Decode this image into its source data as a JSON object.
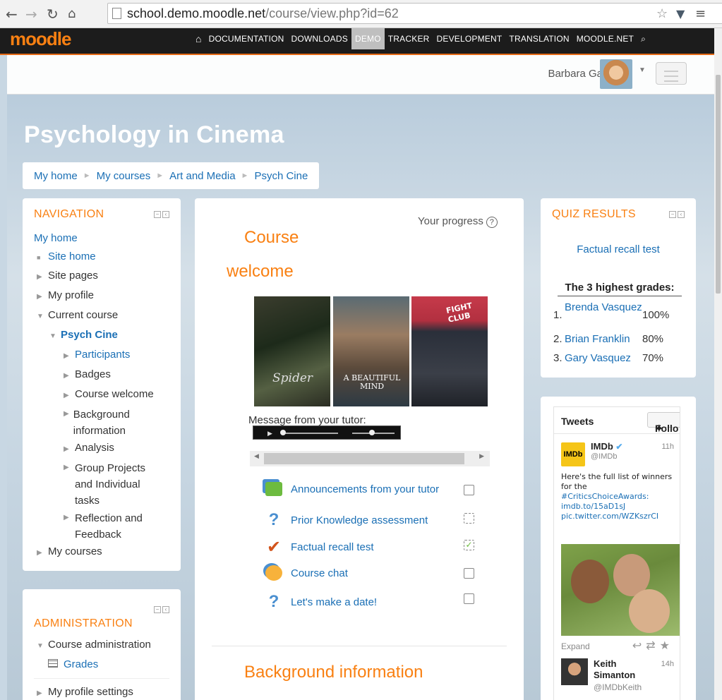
{
  "browser": {
    "url_host": "school.demo.moodle.net",
    "url_path": "/course/view.php?id=62"
  },
  "site": {
    "logo": "moodle",
    "menu": [
      "DOCUMENTATION",
      "DOWNLOADS",
      "DEMO",
      "TRACKER",
      "DEVELOPMENT",
      "TRANSLATION",
      "MOODLE.NET"
    ],
    "active_menu": "DEMO"
  },
  "user": {
    "name": "Barbara Gardner"
  },
  "course": {
    "title": "Psychology in Cinema"
  },
  "breadcrumb": [
    "My home",
    "My courses",
    "Art and Media",
    "Psych Cine"
  ],
  "navigation": {
    "title": "NAVIGATION",
    "my_home": "My home",
    "site_home": "Site home",
    "site_pages": "Site pages",
    "my_profile": "My profile",
    "current_course": "Current course",
    "course_short": "Psych Cine",
    "items": [
      "Participants",
      "Badges",
      "Course welcome",
      "Background information",
      "Analysis",
      "Group Projects and Individual tasks",
      "Reflection and Feedback"
    ],
    "my_courses": "My courses"
  },
  "administration": {
    "title": "ADMINISTRATION",
    "course_admin": "Course administration",
    "grades": "Grades",
    "profile_settings": "My profile settings"
  },
  "main": {
    "progress_label": "Your progress",
    "section_title_1": "Course",
    "section_title_2": "welcome",
    "poster_texts": [
      "Spider",
      "A BEAUTIFUL MIND",
      "FIGHT CLUB"
    ],
    "message_label": "Message from your tutor:",
    "activities": [
      {
        "label": "Announcements from your tutor",
        "icon": "forum-icon"
      },
      {
        "label": "Prior Knowledge assessment",
        "icon": "question-icon"
      },
      {
        "label": "Factual recall test",
        "icon": "quiz-icon"
      },
      {
        "label": "Course chat",
        "icon": "chat-icon"
      },
      {
        "label": "Let's make a date!",
        "icon": "question-icon"
      }
    ],
    "next_section": "Background information"
  },
  "quiz": {
    "title": "QUIZ RESULTS",
    "test_name": "Factual recall test",
    "highest_label": "The 3 highest grades:",
    "results": [
      {
        "rank": "1.",
        "name": "Brenda Vasquez",
        "grade": "100%"
      },
      {
        "rank": "2.",
        "name": "Brian Franklin",
        "grade": "80%"
      },
      {
        "rank": "3.",
        "name": "Gary Vasquez",
        "grade": "70%"
      }
    ]
  },
  "tweets": {
    "title": "Tweets",
    "follow": "Follo",
    "t1_name": "IMDb",
    "t1_handle": "@IMDb",
    "t1_time": "11h",
    "t1_text": "Here's the full list of winners for the",
    "t1_link1": "#CriticsChoiceAwards:",
    "t1_link2": "imdb.to/15aD1sJ",
    "t1_link3": "pic.twitter.com/WZKszrCI",
    "expand": "Expand",
    "t2_name": "Keith Simanton",
    "t2_handle": "@IMDbKeith",
    "t2_time": "14h"
  }
}
